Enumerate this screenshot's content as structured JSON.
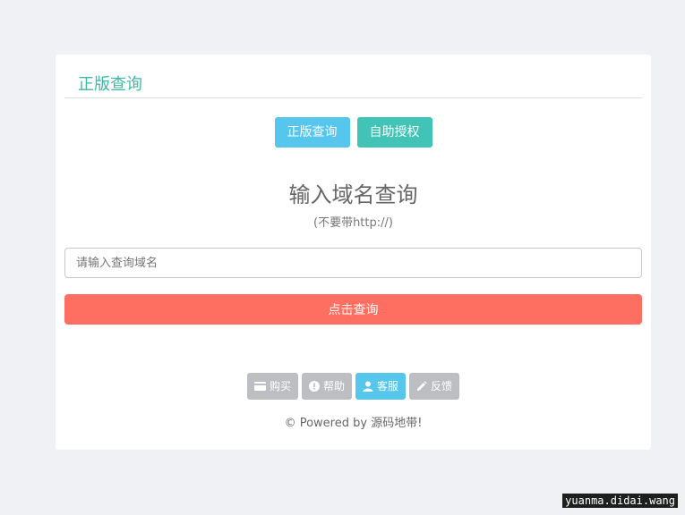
{
  "panel": {
    "title": "正版查询"
  },
  "tabs": {
    "query_label": "正版查询",
    "auth_label": "自助授权"
  },
  "form": {
    "heading": "输入域名查询",
    "subheading": "(不要带http://)",
    "input_placeholder": "请输入查询域名",
    "input_value": "",
    "submit_label": "点击查询"
  },
  "footer_links": [
    {
      "label": "购买",
      "icon": "credit-card-icon"
    },
    {
      "label": "帮助",
      "icon": "exclamation-circle-icon"
    },
    {
      "label": "客服",
      "icon": "user-icon"
    },
    {
      "label": "反馈",
      "icon": "pencil-icon"
    }
  ],
  "powered_by": "© Powered by 源码地带!",
  "watermark": "yuanma.didai.wang",
  "colors": {
    "accent_teal": "#41c4b6",
    "accent_blue": "#56c6ec",
    "submit_red": "#ff6f61",
    "muted_gray": "#bcbec2"
  }
}
